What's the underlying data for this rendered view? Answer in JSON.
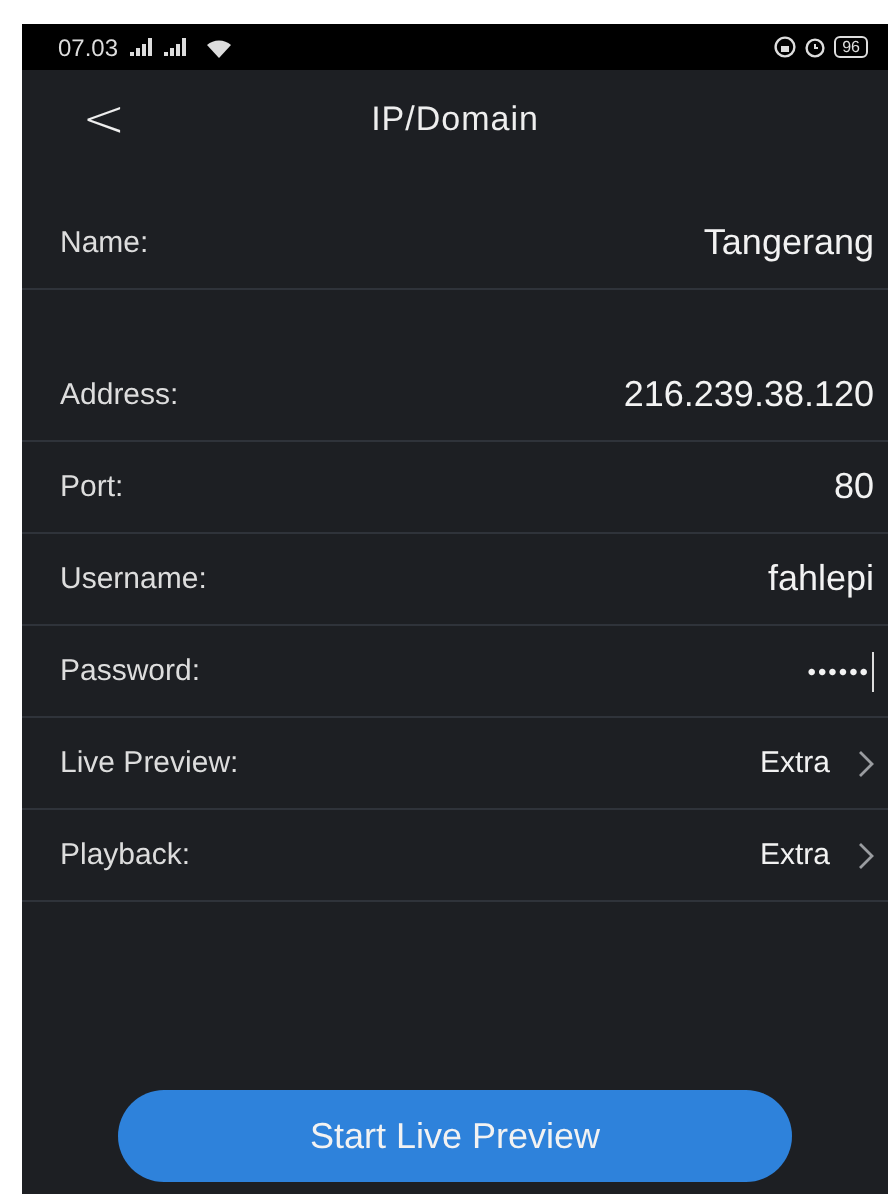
{
  "status_bar": {
    "time": "07.03",
    "battery": "96"
  },
  "header": {
    "back": "<",
    "title": "IP/Domain"
  },
  "groups": [
    {
      "rows": [
        {
          "kind": "field",
          "label": "Name:",
          "value": "Tangerang",
          "focused": false
        }
      ]
    },
    {
      "rows": [
        {
          "kind": "field",
          "label": "Address:",
          "value": "216.239.38.120",
          "focused": false
        },
        {
          "kind": "field",
          "label": "Port:",
          "value": "80",
          "focused": false
        },
        {
          "kind": "field",
          "label": "Username:",
          "value": "fahlepi",
          "focused": false
        },
        {
          "kind": "password",
          "label": "Password:",
          "value": "••••••",
          "focused": true
        },
        {
          "kind": "select",
          "label": "Live Preview:",
          "value": "Extra",
          "focused": false
        },
        {
          "kind": "select",
          "label": "Playback:",
          "value": "Extra",
          "focused": false
        }
      ]
    }
  ],
  "button": "Start Live Preview"
}
